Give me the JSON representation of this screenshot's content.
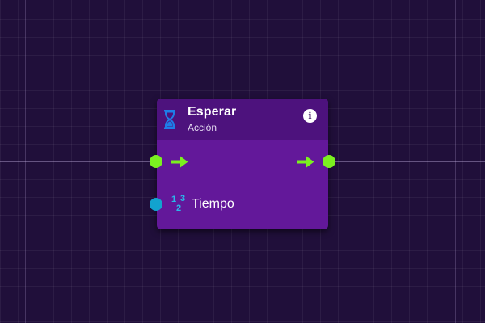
{
  "node": {
    "title": "Esperar",
    "subtitle": "Acción",
    "icon": "hourglass-icon",
    "info_icon": "info-icon",
    "info_glyph": "i"
  },
  "inputs": [
    {
      "type": "exec",
      "label": ""
    },
    {
      "type": "number",
      "label": "Tiempo",
      "icon": "number-type-icon",
      "icon_glyphs": [
        "1",
        "3",
        "2"
      ]
    }
  ],
  "outputs": [
    {
      "type": "exec",
      "label": ""
    }
  ],
  "colors": {
    "canvas_bg": "#200f3a",
    "node_body": "#63189a",
    "node_header": "#4d127d",
    "exec_pin": "#7bf020",
    "number_pin": "#12a3cf",
    "hourglass": "#1e7de8"
  }
}
